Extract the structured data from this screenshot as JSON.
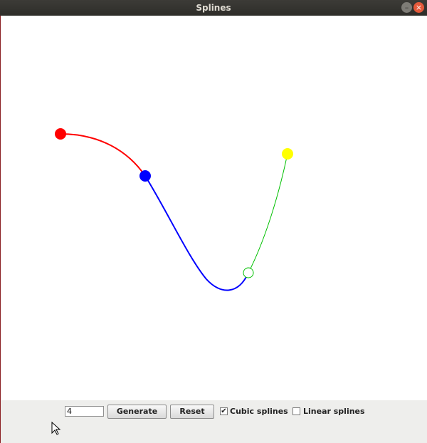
{
  "window": {
    "title": "Splines",
    "minimize_icon": "minimize-icon",
    "close_icon": "close-icon"
  },
  "canvas": {
    "points": [
      {
        "name": "red",
        "color": "#ff0000",
        "filled": true
      },
      {
        "name": "blue",
        "color": "#0000ff",
        "filled": true
      },
      {
        "name": "green",
        "color": "#00c000",
        "filled": false
      },
      {
        "name": "yellow",
        "color": "#ffff00",
        "filled": true
      }
    ],
    "segments": [
      {
        "from": "red",
        "to": "blue",
        "color": "#ff0000"
      },
      {
        "from": "blue",
        "to": "green",
        "color": "#0000ff"
      },
      {
        "from": "green",
        "to": "yellow",
        "color": "#00c000"
      }
    ]
  },
  "controls": {
    "count_value": "4",
    "generate_label": "Generate",
    "reset_label": "Reset",
    "cubic_label": "Cubic splines",
    "cubic_checked": true,
    "linear_label": "Linear splines",
    "linear_checked": false
  }
}
